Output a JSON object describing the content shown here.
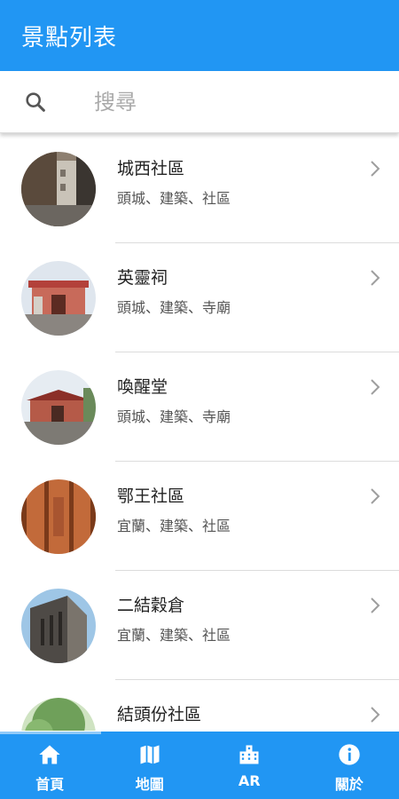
{
  "appbar": {
    "title": "景點列表"
  },
  "search": {
    "placeholder": "搜尋",
    "icon": "search-icon"
  },
  "items": [
    {
      "name": "城西社區",
      "tags": "頭城、建築、社區"
    },
    {
      "name": "英靈祠",
      "tags": "頭城、建築、寺廟"
    },
    {
      "name": "喚醒堂",
      "tags": "頭城、建築、寺廟"
    },
    {
      "name": "鄂王社區",
      "tags": "宜蘭、建築、社區"
    },
    {
      "name": "二結穀倉",
      "tags": "宜蘭、建築、社區"
    },
    {
      "name": "結頭份社區",
      "tags": ""
    }
  ],
  "nav": [
    {
      "label": "首頁",
      "icon": "home-icon"
    },
    {
      "label": "地圖",
      "icon": "map-icon"
    },
    {
      "label": "AR",
      "icon": "building-icon"
    },
    {
      "label": "關於",
      "icon": "info-icon"
    }
  ],
  "colors": {
    "primary": "#2196f3",
    "selected_indicator": "#90caf9"
  }
}
